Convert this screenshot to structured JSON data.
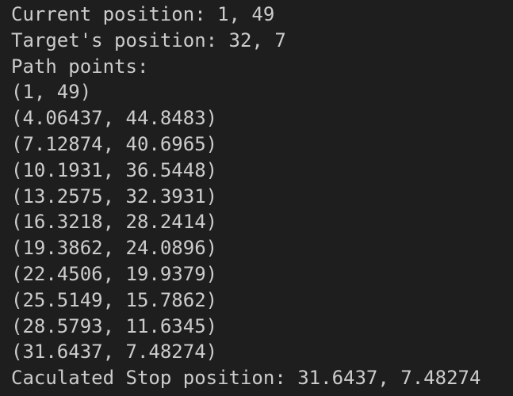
{
  "terminal": {
    "lines": [
      "Current position: 1, 49",
      "Target's position: 32, 7",
      "Path points:",
      "(1, 49)",
      "(4.06437, 44.8483)",
      "(7.12874, 40.6965)",
      "(10.1931, 36.5448)",
      "(13.2575, 32.3931)",
      "(16.3218, 28.2414)",
      "(19.3862, 24.0896)",
      "(22.4506, 19.9379)",
      "(25.5149, 15.7862)",
      "(28.5793, 11.6345)",
      "(31.6437, 7.48274)",
      "Caculated Stop position: 31.6437, 7.48274"
    ]
  }
}
